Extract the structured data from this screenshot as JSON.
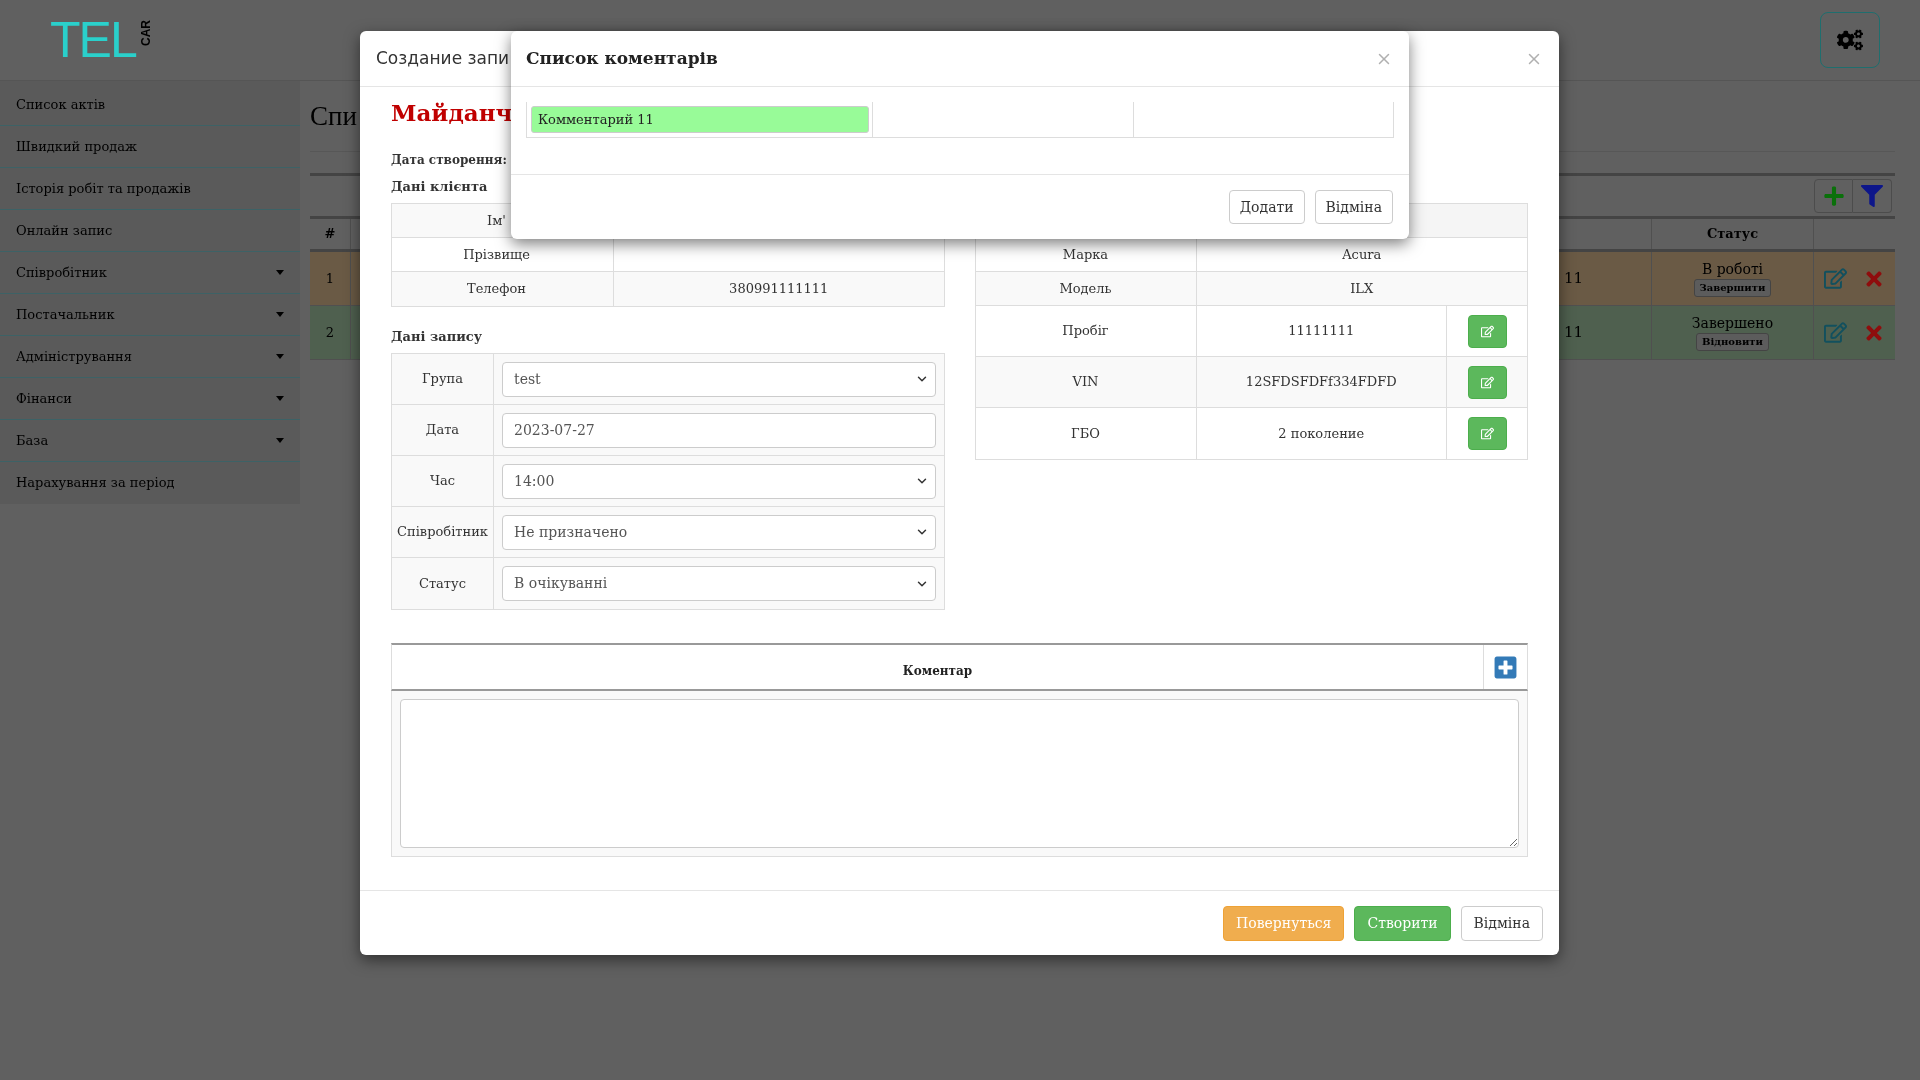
{
  "header": {
    "logo": {
      "wordmark": "TEL",
      "tagline": "CAR"
    }
  },
  "sidebar": {
    "items": [
      {
        "label": "Список актів",
        "has_submenu": false
      },
      {
        "label": "Швидкий продаж",
        "has_submenu": false
      },
      {
        "label": "Історія робіт та продажів",
        "has_submenu": false
      },
      {
        "label": "Онлайн запис",
        "has_submenu": false
      },
      {
        "label": "Співробітник",
        "has_submenu": true
      },
      {
        "label": "Постачальник",
        "has_submenu": true
      },
      {
        "label": "Адміністрування",
        "has_submenu": true
      },
      {
        "label": "Фінанси",
        "has_submenu": true
      },
      {
        "label": "База",
        "has_submenu": true
      },
      {
        "label": "Нарахування за період",
        "has_submenu": false
      }
    ]
  },
  "page": {
    "title": "Спи",
    "table": {
      "columns": {
        "number": "#",
        "status": "Статус"
      },
      "rows": [
        {
          "number": "1",
          "cut_column": "11",
          "status": "В роботі",
          "status_action": "Завершити",
          "color": "#6a5a45"
        },
        {
          "number": "2",
          "cut_column": "11",
          "status": "Завершено",
          "status_action": "Відновити",
          "color": "#4f604f"
        }
      ]
    }
  },
  "create_dialog": {
    "title": "Создание запи",
    "heading": "Майданч",
    "created_label": "Дата створення:",
    "client": {
      "title": "Дані клієнта",
      "rows": [
        {
          "label": "Ім'"
        },
        {
          "label": "Прізвище"
        },
        {
          "label": "Телефон",
          "value": "380991111111"
        }
      ]
    },
    "record": {
      "title": "Дані запису",
      "rows": [
        {
          "label": "Група",
          "kind": "select",
          "value": "test"
        },
        {
          "label": "Дата",
          "kind": "date",
          "value": "2023-07-27"
        },
        {
          "label": "Час",
          "kind": "select",
          "value": "14:00"
        },
        {
          "label": "Співробітник",
          "kind": "select",
          "value": "Не призначено"
        },
        {
          "label": "Статус",
          "kind": "select",
          "value": "В очікуванні"
        }
      ]
    },
    "vehicle": {
      "rows": [
        {
          "label": "Марка",
          "value": "Acura",
          "editable": false
        },
        {
          "label": "Модель",
          "value": "ILX",
          "editable": false
        },
        {
          "label": "Пробіг",
          "value": "11111111",
          "editable": true
        },
        {
          "label": "VIN",
          "value": "12SFDSFDFf334FDFD",
          "editable": true
        },
        {
          "label": "ГБО",
          "value": "2 поколение",
          "editable": true
        }
      ]
    },
    "comment": {
      "title": "Коментар"
    },
    "buttons": [
      {
        "label": "Повернуться",
        "kind": "warning"
      },
      {
        "label": "Створити",
        "kind": "primary"
      },
      {
        "label": "Відміна",
        "kind": "default"
      }
    ]
  },
  "comments_dialog": {
    "title": "Список коментарів",
    "comments": [
      {
        "value": "Комментарий 11"
      }
    ],
    "buttons": [
      {
        "label": "Додати"
      },
      {
        "label": "Відміна"
      }
    ]
  }
}
